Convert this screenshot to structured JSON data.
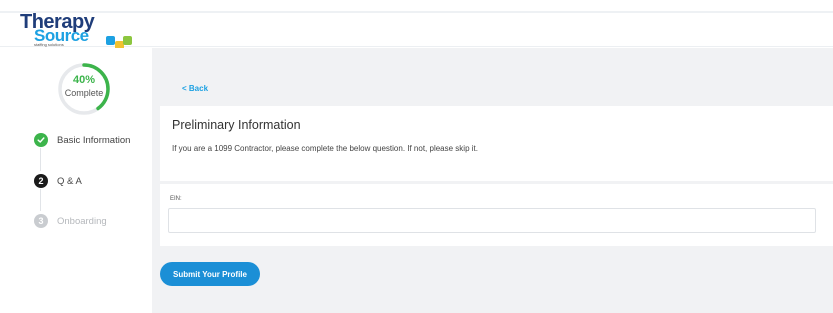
{
  "logo": {
    "line1": "Therapy",
    "line2": "Source",
    "tagline": "staffing solutions"
  },
  "progress": {
    "percent_text": "40%",
    "percent_value": 0.4,
    "label": "Complete",
    "color": "#3cb44b"
  },
  "steps": [
    {
      "icon": "check-icon",
      "marker": "",
      "label": "Basic Information",
      "status": "complete"
    },
    {
      "icon": "",
      "marker": "2",
      "label": "Q & A",
      "status": "active"
    },
    {
      "icon": "",
      "marker": "3",
      "label": "Onboarding",
      "status": "upcoming"
    }
  ],
  "main": {
    "back_label": "< Back",
    "title": "Preliminary Information",
    "description": "If you are a 1099 Contractor, please complete the below question. If not, please skip it.",
    "field_label": "EIN:",
    "field_value": "",
    "field_placeholder": "",
    "submit_label": "Submit Your Profile"
  },
  "colors": {
    "accent": "#1da1e2",
    "button": "#1b8fd6",
    "success": "#3cb44b"
  }
}
